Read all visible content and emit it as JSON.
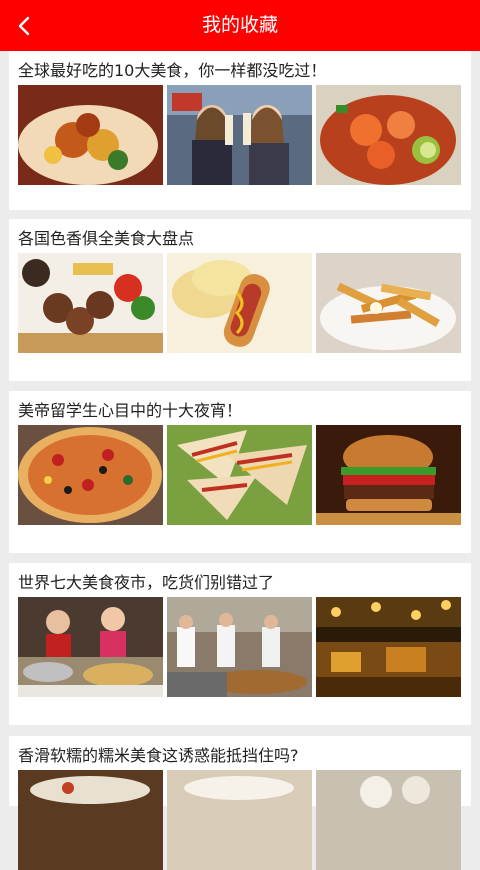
{
  "header": {
    "title": "我的收藏",
    "background": "#ff0000"
  },
  "items": [
    {
      "title": "全球最好吃的10大美食，你一样都没吃过！",
      "images": [
        "food-plate-photo",
        "people-with-ice-cream-photo",
        "shrimp-soup-photo"
      ]
    },
    {
      "title": "各国色香俱全美食大盘点",
      "images": [
        "takoyaki-photo",
        "hot-dog-chips-photo",
        "poutine-fries-photo"
      ]
    },
    {
      "title": "美帝留学生心目中的十大夜宵！",
      "images": [
        "pizza-photo",
        "quesadilla-photo",
        "burger-photo"
      ]
    },
    {
      "title": "世界七大美食夜市，吃货们别错过了",
      "images": [
        "market-stall-photo",
        "street-food-market-photo",
        "night-market-photo"
      ]
    },
    {
      "title": "香滑软糯的糯米美食这诱惑能抵挡住吗?",
      "images": [
        "rice-dish-photo",
        "rice-cake-photo",
        "rice-ball-photo"
      ]
    }
  ]
}
